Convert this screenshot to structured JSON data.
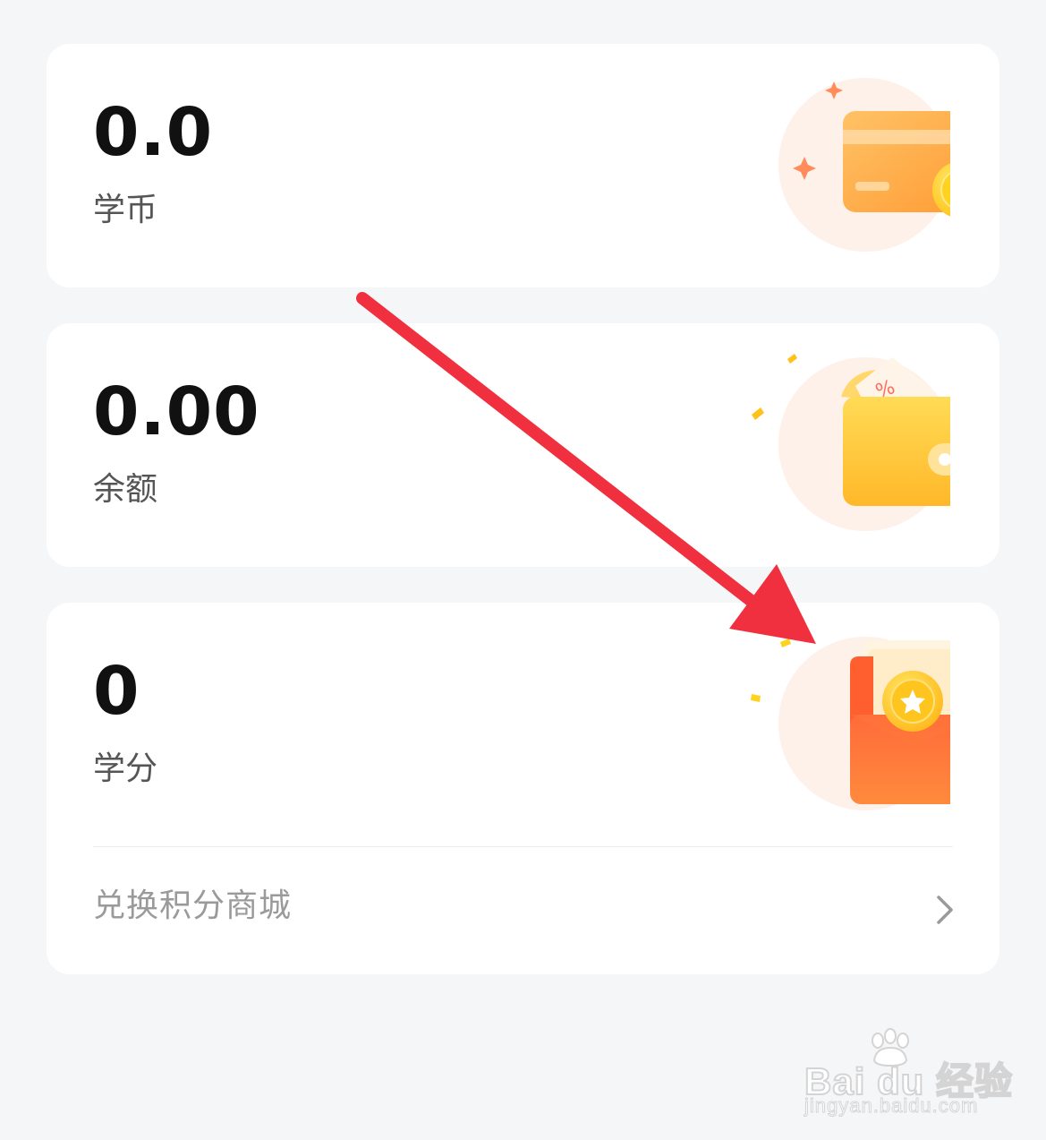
{
  "cards": {
    "coins": {
      "value": "0.0",
      "label": "学币",
      "icon": "credit-card-coin-icon"
    },
    "balance": {
      "value": "0.00",
      "label": "余额",
      "icon": "wallet-icon"
    },
    "credits": {
      "value": "0",
      "label": "学分",
      "icon": "red-envelope-star-icon"
    }
  },
  "exchange_link": {
    "label": "兑换积分商城",
    "icon": "chevron-right-icon"
  },
  "annotation": {
    "icon": "red-arrow-annotation",
    "color": "#f0303f"
  },
  "watermark": {
    "brand": "Bai du 经验",
    "url": "jingyan.baidu.com"
  },
  "colors": {
    "page_bg": "#f5f6f8",
    "card_bg": "#ffffff",
    "value_text": "#111111",
    "label_text": "#555555",
    "link_text": "#9a9a9a"
  }
}
